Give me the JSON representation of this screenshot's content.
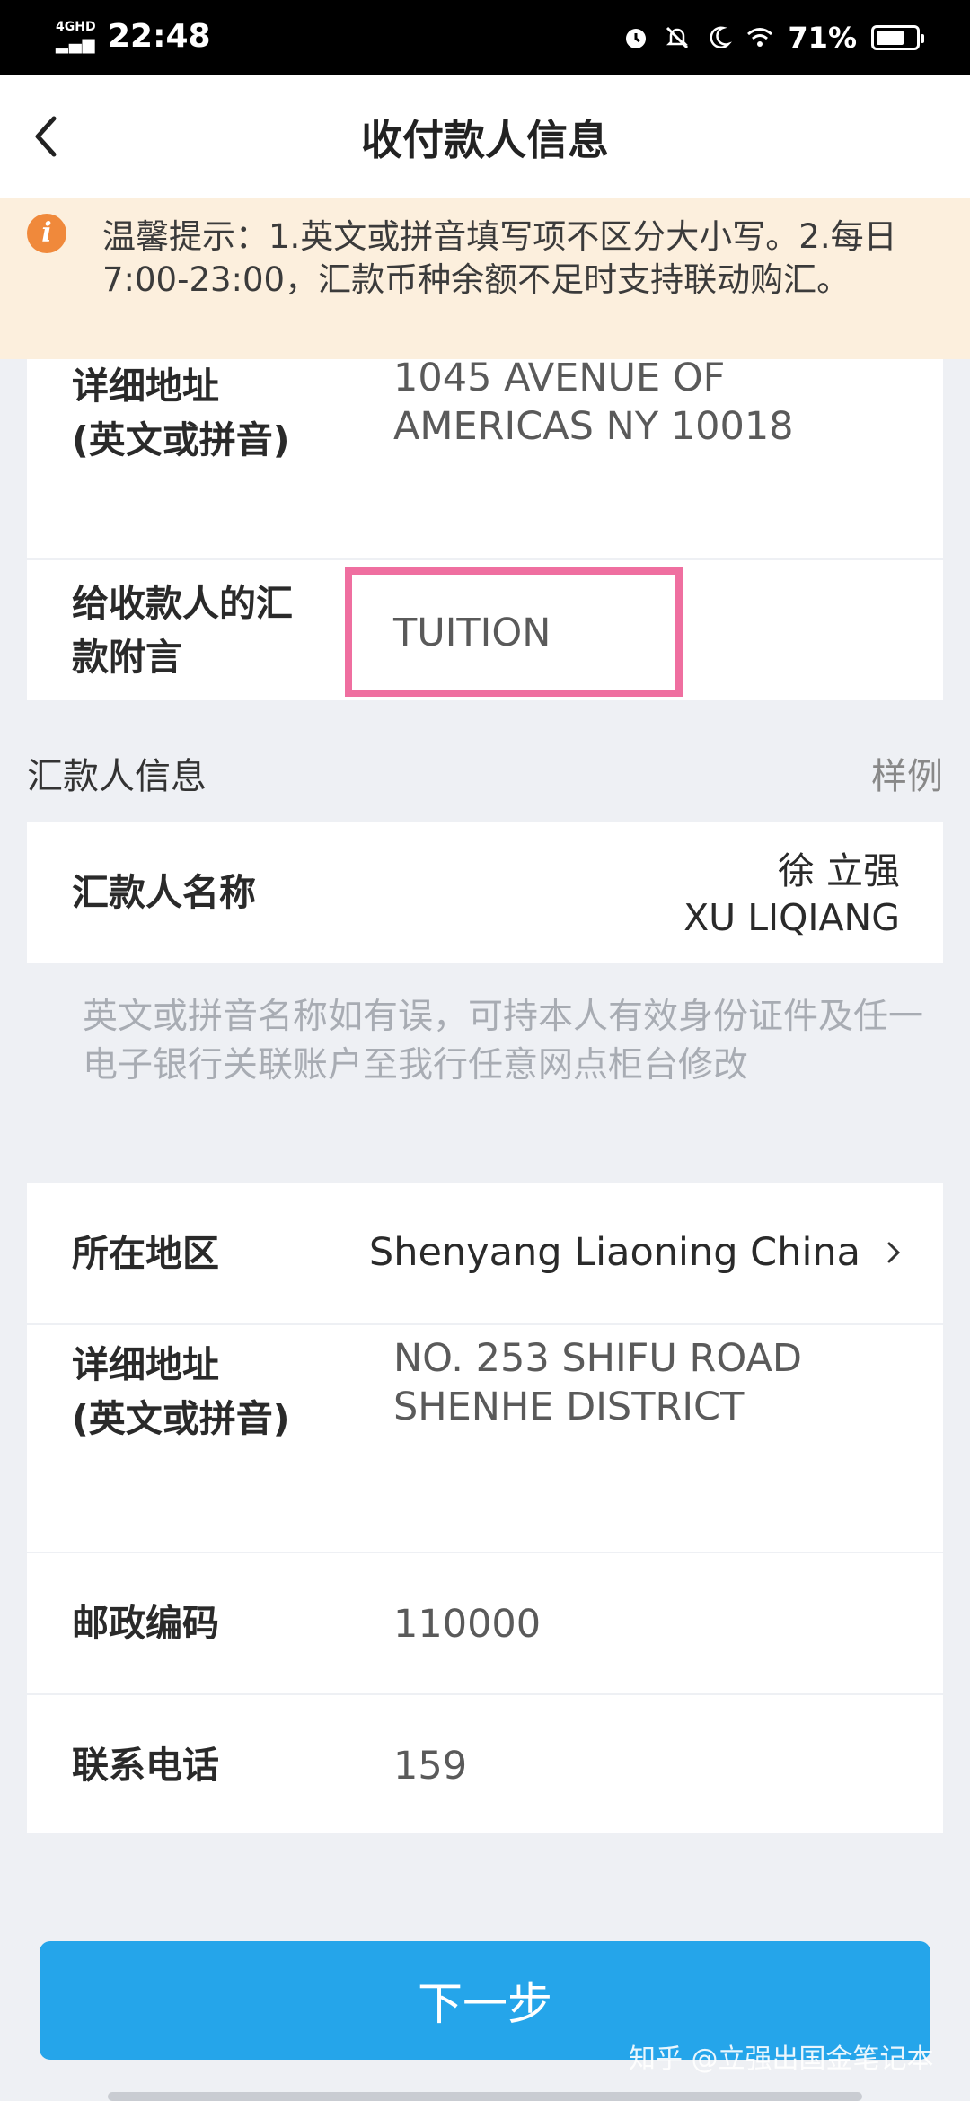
{
  "status_bar": {
    "network": "4GHD",
    "time": "22:48",
    "battery": "71%",
    "battery_level": 0.71
  },
  "header": {
    "title": "收付款人信息",
    "back_icon": "chevron-left-icon"
  },
  "notice": {
    "icon": "info-icon",
    "icon_glyph": "i",
    "text": "温馨提示：1.英文或拼音填写项不区分大小写。2.每日7:00-23:00，汇款币种余额不足时支持联动购汇。"
  },
  "payee": {
    "address_label_line1": "详细地址",
    "address_label_line2": "(英文或拼音)",
    "address_line1": "1045 AVENUE OF",
    "address_line2": "AMERICAS NY 10018",
    "memo_label_line1": "给收款人的汇",
    "memo_label_line2": "款附言",
    "memo_value": "TUITION"
  },
  "remitter_section": {
    "title": "汇款人信息",
    "sample_link": "样例",
    "name_label": "汇款人名称",
    "name_chinese": "徐 立强",
    "name_pinyin": "XU LIQIANG",
    "helper_text": "英文或拼音名称如有误，可持本人有效身份证件及任一电子银行关联账户至我行任意网点柜台修改"
  },
  "remitter_details": {
    "region_label": "所在地区",
    "region_value": "Shenyang Liaoning China",
    "address_label_line1": "详细地址",
    "address_label_line2": "(英文或拼音)",
    "address_line1": "NO. 253 SHIFU ROAD",
    "address_line2": "SHENHE DISTRICT",
    "postcode_label": "邮政编码",
    "postcode_value": "110000",
    "phone_label": "联系电话",
    "phone_value": "159"
  },
  "footer": {
    "next_button": "下一步",
    "watermark": "知乎 @立强出国金笔记本"
  },
  "colors": {
    "accent": "#25a5ea",
    "notice_bg": "#fcefdd",
    "notice_icon": "#f0893b",
    "highlight": "#ef6fa0",
    "page_bg": "#eef0f4"
  }
}
